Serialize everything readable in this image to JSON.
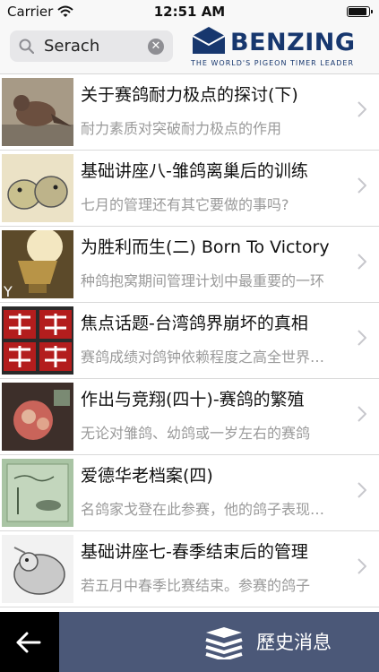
{
  "status_bar": {
    "carrier": "Carrier",
    "time": "12:51 AM",
    "battery_level": 0.9
  },
  "search": {
    "value": "Serach",
    "placeholder": "Serach"
  },
  "brand": {
    "name": "BENZING",
    "tagline": "THE WORLD'S PIGEON TIMER LEADER",
    "color": "#17376e"
  },
  "articles": [
    {
      "title": "关于赛鸽耐力极点的探讨(下)",
      "subtitle": "耐力素质对突破耐力极点的作用",
      "thumb_icon": "pigeon-photo-icon"
    },
    {
      "title": "基础讲座八-雏鸽离巢后的训练",
      "subtitle": "七月的管理还有其它要做的事吗?",
      "thumb_icon": "cartoon-pigeons-icon"
    },
    {
      "title": "为胜利而生(二) Born To Victory",
      "subtitle": "种鸽抱窝期间管理计划中最重要的一环",
      "thumb_icon": "trophy-icon"
    },
    {
      "title": "焦点话题-台湾鸽界崩坏的真相",
      "subtitle": "赛鸽成绩对鸽钟依赖程度之高全世界仅见",
      "thumb_icon": "collapse-text-icon"
    },
    {
      "title": "作出与竞翔(四十)-赛鸽的繁殖",
      "subtitle": "无论对雏鸽、幼鸽或一岁左右的赛鸽",
      "thumb_icon": "nest-photo-icon"
    },
    {
      "title": "爱德华老档案(四)",
      "subtitle": "名鸽家戈登在此参赛，他的鸽子表现出色",
      "thumb_icon": "old-book-icon"
    },
    {
      "title": "基础讲座七-春季结束后的管理",
      "subtitle": "若五月中春季比赛结束。参赛的鸽子",
      "thumb_icon": "cartoon-pigeon-icon"
    }
  ],
  "tabbar": {
    "back_icon": "back-arrow-icon",
    "history_icon": "stack-icon",
    "history_label": "歷史消息",
    "history_color": "#4b5878"
  }
}
